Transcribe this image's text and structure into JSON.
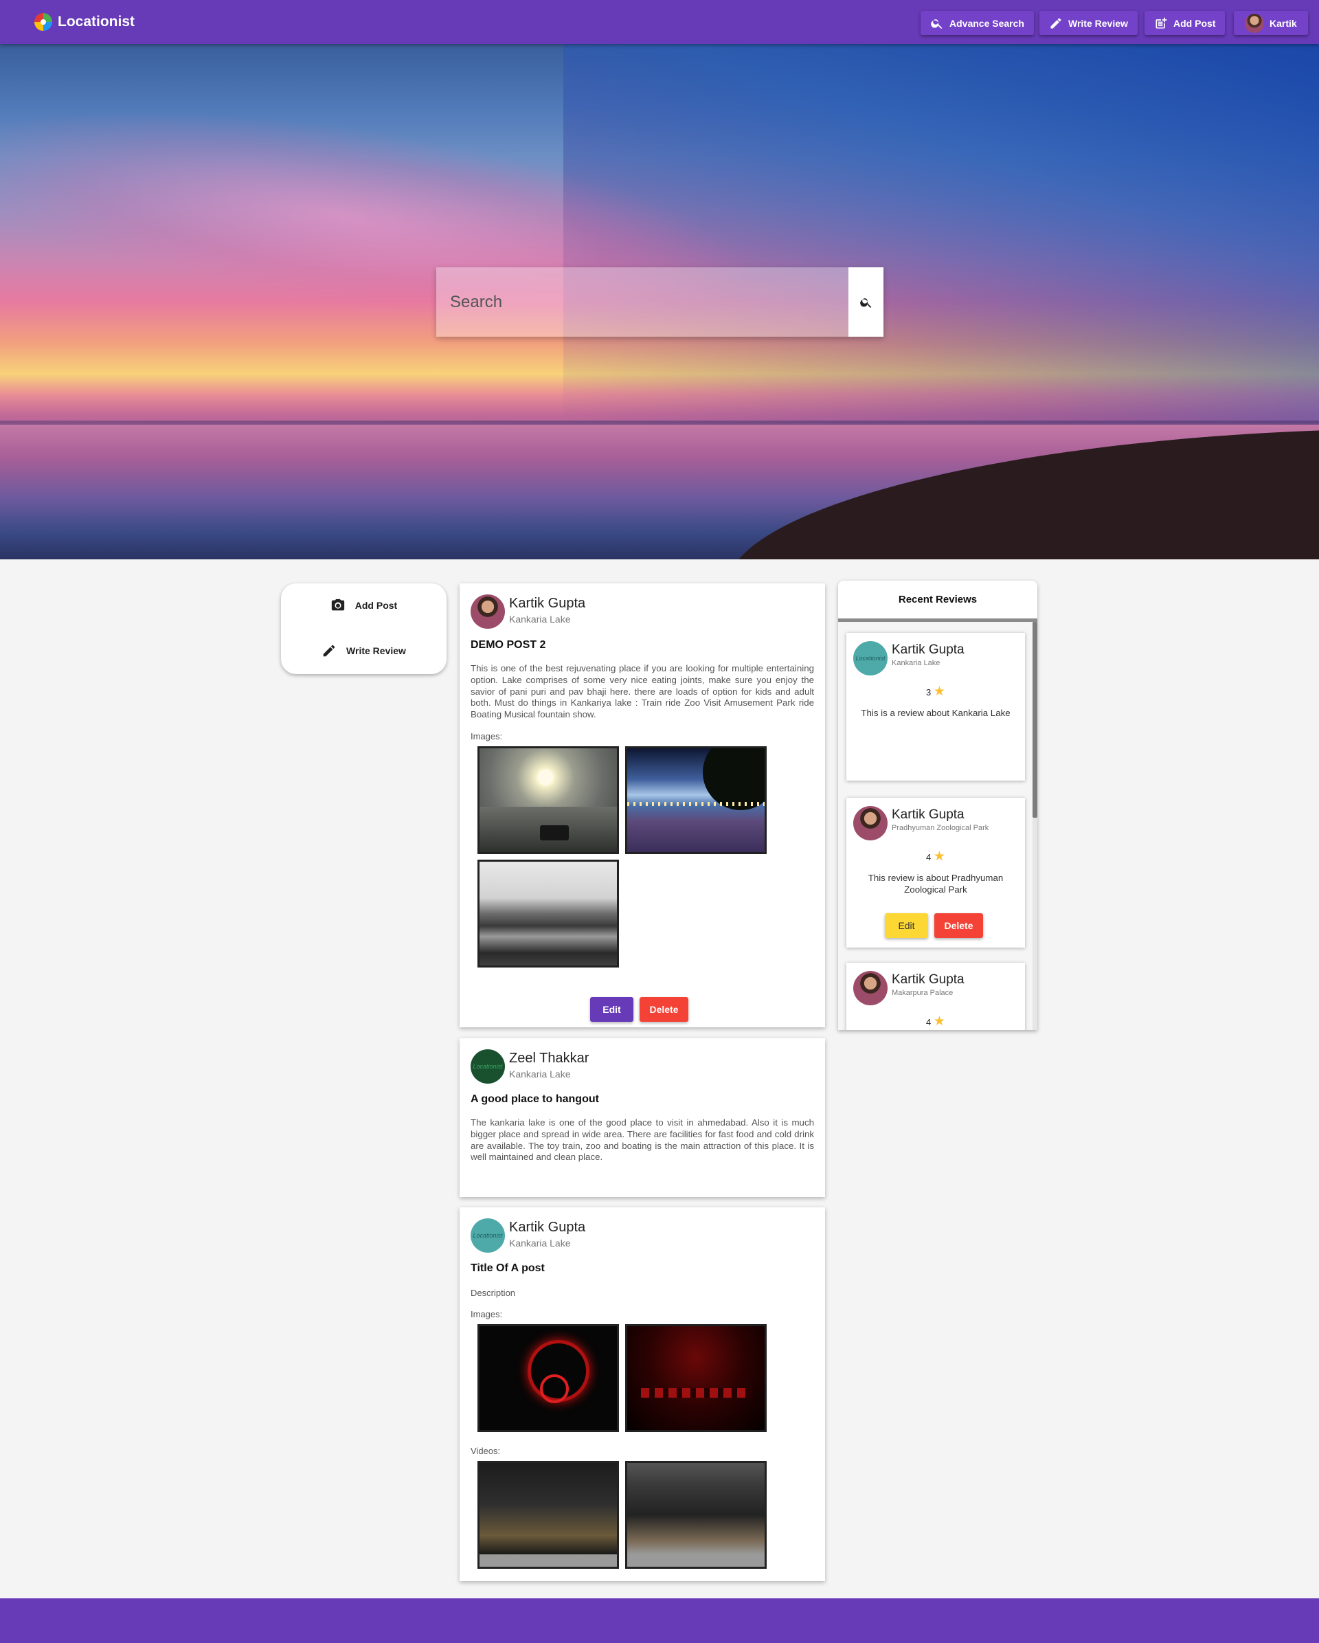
{
  "navbar": {
    "brand": "Locationist",
    "buttons": [
      {
        "label": "Advance Search",
        "icon": "search-icon"
      },
      {
        "label": "Write Review",
        "icon": "pencil-icon"
      },
      {
        "label": "Add Post",
        "icon": "post-add-icon"
      },
      {
        "label": "Kartik",
        "icon": "avatar"
      }
    ]
  },
  "hero": {
    "search_placeholder": "Search"
  },
  "sidebar": {
    "actions": [
      {
        "label": "Add Post",
        "icon": "camera-icon"
      },
      {
        "label": "Write Review",
        "icon": "pencil-icon"
      }
    ]
  },
  "posts": [
    {
      "author": "Kartik Gupta",
      "place": "Kankaria Lake",
      "title": "DEMO POST 2",
      "description": "This is one of the best rejuvenating place if you are looking for multiple entertaining option. Lake comprises of some very nice eating joints, make sure you enjoy the savior of pani puri and pav bhaji here. there are loads of option for kids and adult both. Must do things in Kankariya lake : Train ride Zoo Visit Amusement Park ride Boating Musical fountain show.",
      "images_label": "Images:",
      "edit_label": "Edit",
      "delete_label": "Delete"
    },
    {
      "author": "Zeel Thakkar",
      "place": "Kankaria Lake",
      "avatar_text": "Locationist",
      "title": "A good place to hangout",
      "description": "The kankaria lake is one of the good place to visit in ahmedabad. Also it is much bigger place and spread in wide area. There are facilities for fast food and cold drink are available. The toy train, zoo and boating is the main attraction of this place. It is well maintained and clean place."
    },
    {
      "author": "Kartik Gupta",
      "place": "Kankaria Lake",
      "avatar_text": "Locationist",
      "title": "Title Of A post",
      "description": "Description",
      "images_label": "Images:",
      "videos_label": "Videos:"
    }
  ],
  "reviews": {
    "title": "Recent Reviews",
    "items": [
      {
        "author": "Kartik Gupta",
        "place": "Kankaria Lake",
        "avatar_text": "Locationist",
        "rating": "3",
        "text": "This is a review about Kankaria Lake"
      },
      {
        "author": "Kartik Gupta",
        "place": "Pradhyuman Zoological Park",
        "rating": "4",
        "text": "This review is about Pradhyuman Zoological Park",
        "edit_label": "Edit",
        "delete_label": "Delete"
      },
      {
        "author": "Kartik Gupta",
        "place": "Makarpura Palace",
        "rating": "4"
      }
    ],
    "star": "★"
  },
  "colors": {
    "primary": "#673ab7",
    "danger": "#f44336",
    "warning": "#fdd835",
    "star": "#fbc02d"
  }
}
